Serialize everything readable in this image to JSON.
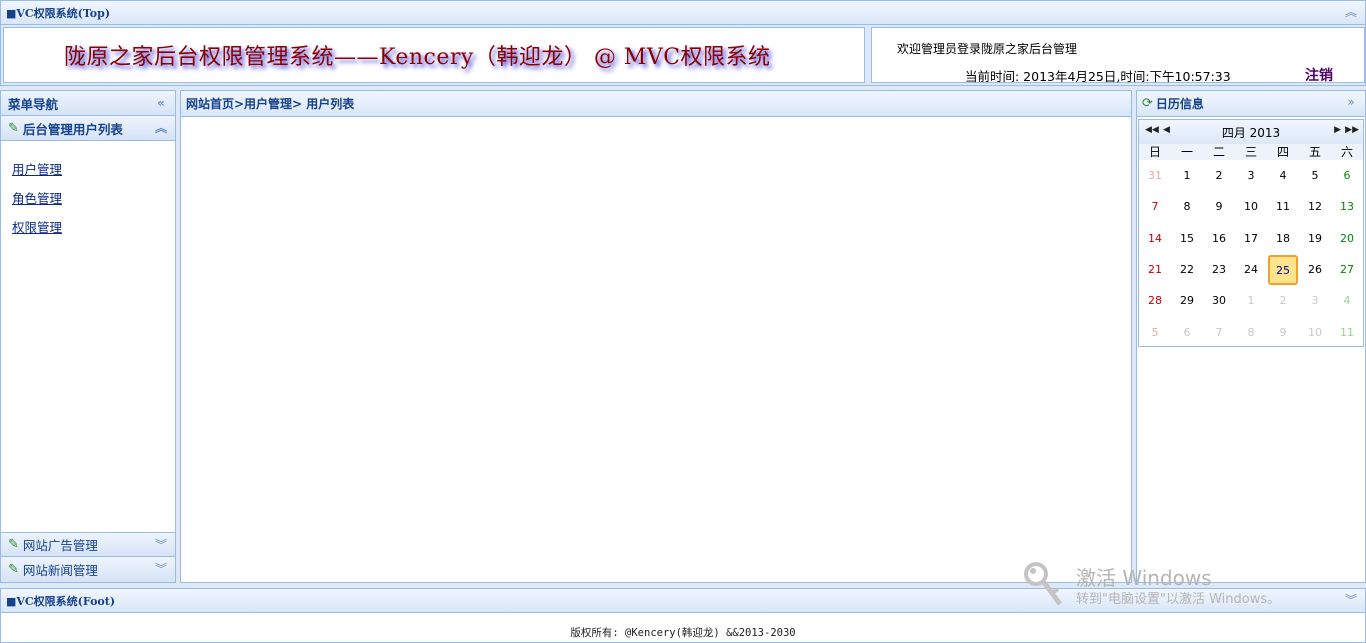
{
  "top": {
    "title": "■VC权限系统(Top)",
    "banner_title": "陇原之家后台权限管理系统——Kencery（韩迎龙） @ MVC权限系统",
    "welcome": "欢迎管理员登录陇原之家后台管理",
    "time": "当前时间: 2013年4月25日,时间:下午10:57:33",
    "logout": "注销"
  },
  "left": {
    "title": "菜单导航",
    "section_active": "后台管理用户列表",
    "links": [
      "用户管理",
      "角色管理",
      "权限管理"
    ],
    "section_ads": "网站广告管理",
    "section_news": "网站新闻管理"
  },
  "center": {
    "breadcrumb": "网站首页>用户管理> 用户列表"
  },
  "right": {
    "title": "日历信息",
    "calendar": {
      "month_label": "四月 2013",
      "weekdays": [
        "日",
        "一",
        "二",
        "三",
        "四",
        "五",
        "六"
      ],
      "today": "25",
      "weeks": [
        [
          {
            "d": "31",
            "o": true
          },
          {
            "d": "1"
          },
          {
            "d": "2"
          },
          {
            "d": "3"
          },
          {
            "d": "4"
          },
          {
            "d": "5"
          },
          {
            "d": "6"
          }
        ],
        [
          {
            "d": "7"
          },
          {
            "d": "8"
          },
          {
            "d": "9"
          },
          {
            "d": "10"
          },
          {
            "d": "11"
          },
          {
            "d": "12"
          },
          {
            "d": "13"
          }
        ],
        [
          {
            "d": "14"
          },
          {
            "d": "15"
          },
          {
            "d": "16"
          },
          {
            "d": "17"
          },
          {
            "d": "18"
          },
          {
            "d": "19"
          },
          {
            "d": "20"
          }
        ],
        [
          {
            "d": "21"
          },
          {
            "d": "22"
          },
          {
            "d": "23"
          },
          {
            "d": "24"
          },
          {
            "d": "25"
          },
          {
            "d": "26"
          },
          {
            "d": "27"
          }
        ],
        [
          {
            "d": "28"
          },
          {
            "d": "29"
          },
          {
            "d": "30"
          },
          {
            "d": "1",
            "o": true
          },
          {
            "d": "2",
            "o": true
          },
          {
            "d": "3",
            "o": true
          },
          {
            "d": "4",
            "o": true
          }
        ],
        [
          {
            "d": "5",
            "o": true
          },
          {
            "d": "6",
            "o": true
          },
          {
            "d": "7",
            "o": true
          },
          {
            "d": "8",
            "o": true
          },
          {
            "d": "9",
            "o": true
          },
          {
            "d": "10",
            "o": true
          },
          {
            "d": "11",
            "o": true
          }
        ]
      ]
    }
  },
  "foot": {
    "title": "■VC权限系统(Foot)",
    "copyright": "版权所有: @Kencery(韩迎龙) &&2013-2030"
  },
  "watermark": {
    "title": "激活 Windows",
    "subtitle": "转到\"电脑设置\"以激活 Windows。"
  },
  "colors": {
    "border": "#99bbe8",
    "header_text": "#15428b",
    "banner_text": "#8b0000",
    "today_bg": "#ffe48d"
  }
}
